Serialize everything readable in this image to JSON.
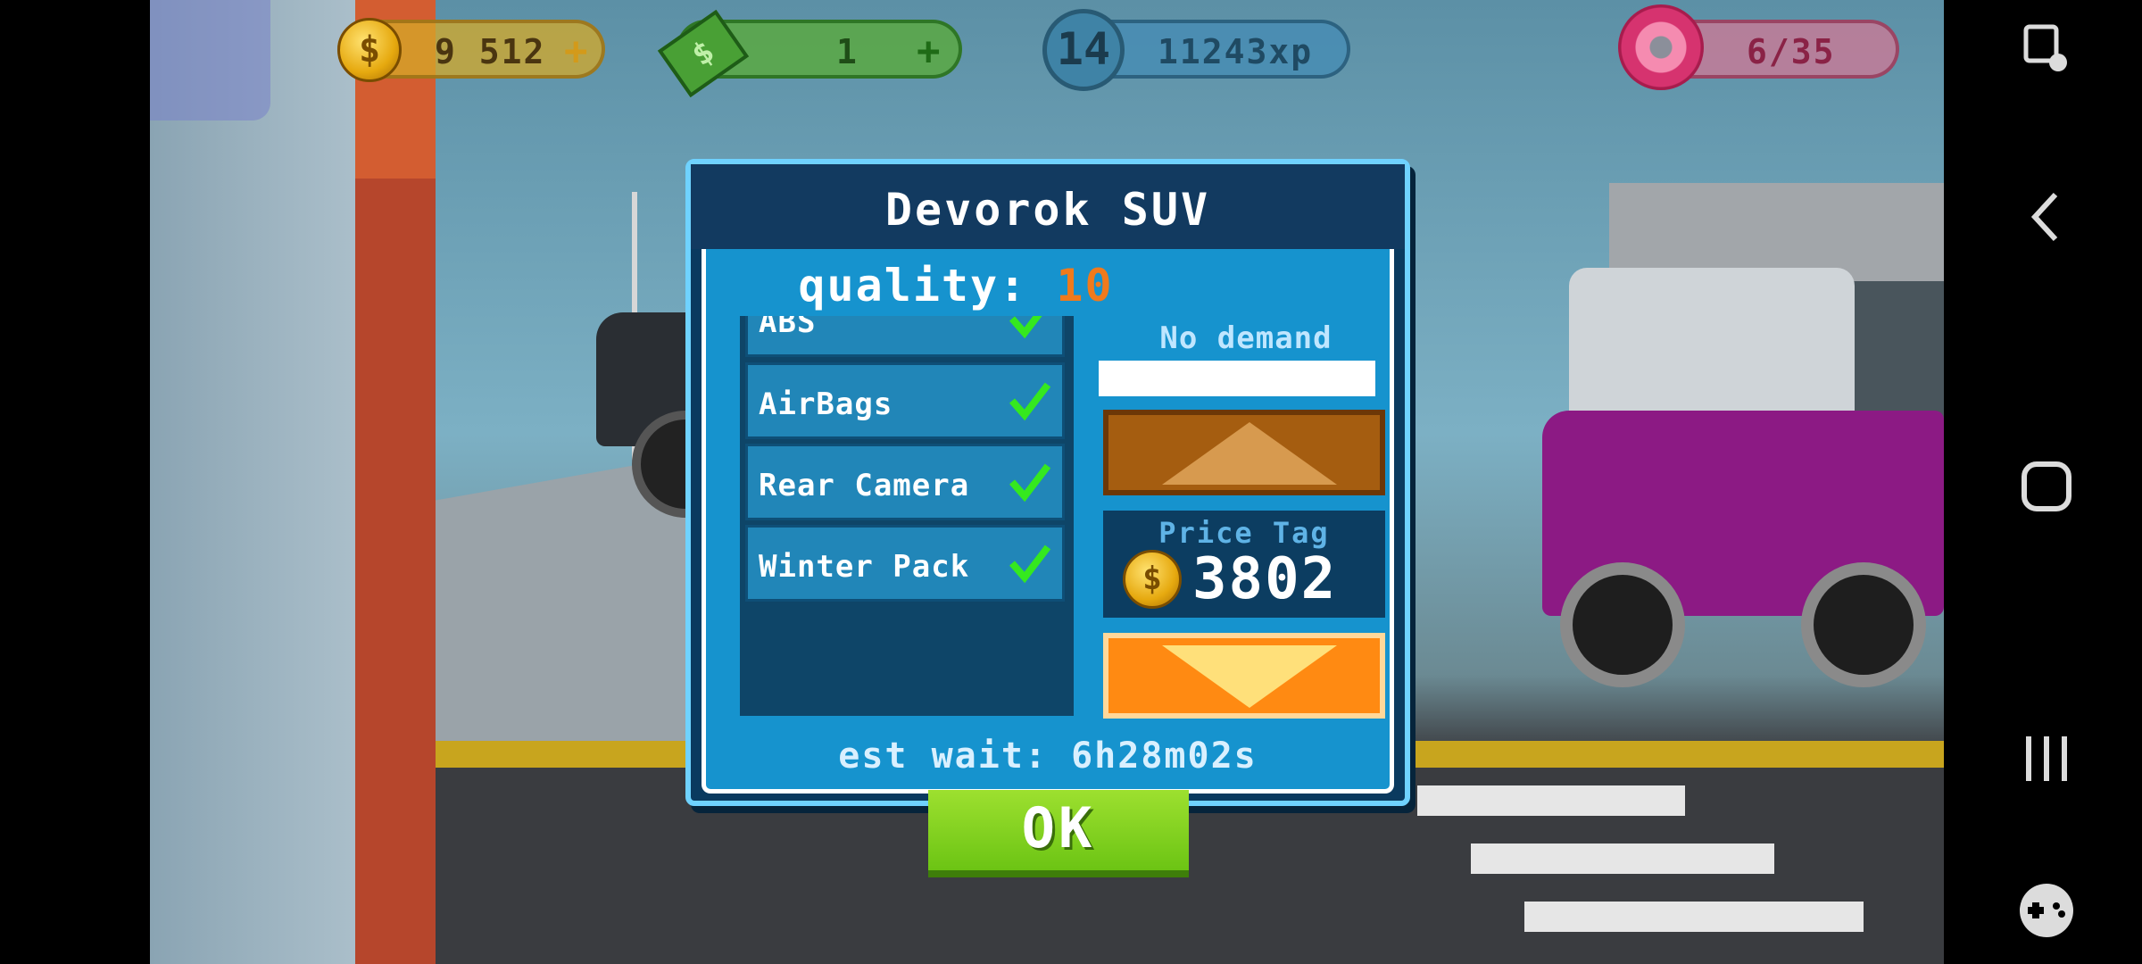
{
  "hud": {
    "coins": "9 512",
    "cash": "1",
    "level": "14",
    "xp": "11243xp",
    "donuts": "6/35"
  },
  "dialog": {
    "title": "Devorok SUV",
    "quality_label": "quality:",
    "quality_value": "10",
    "features": [
      {
        "label": "ABS",
        "checked": true
      },
      {
        "label": "AirBags",
        "checked": true
      },
      {
        "label": "Rear Camera",
        "checked": true
      },
      {
        "label": "Winter Pack",
        "checked": true
      }
    ],
    "demand_label": "No demand",
    "price_label": "Price Tag",
    "price_value": "3802",
    "wait_text": "est wait: 6h28m02s",
    "ok_label": "OK"
  },
  "colors": {
    "dialog_bg": "#1693ce",
    "dialog_border": "#6fd2ff",
    "quality_accent": "#f07a1c",
    "ok_green": "#7bd11b",
    "check_green": "#35e81f"
  },
  "icons": {
    "coin": "coin-icon",
    "cash": "cash-icon",
    "level": "level-badge",
    "donut": "donut-icon",
    "check": "check-icon",
    "up": "up-arrow-icon",
    "down": "down-arrow-icon",
    "screen_capture": "screen-capture-icon",
    "back": "back-icon",
    "home": "home-icon",
    "recents": "recents-icon",
    "game_tools": "gamepad-icon"
  }
}
